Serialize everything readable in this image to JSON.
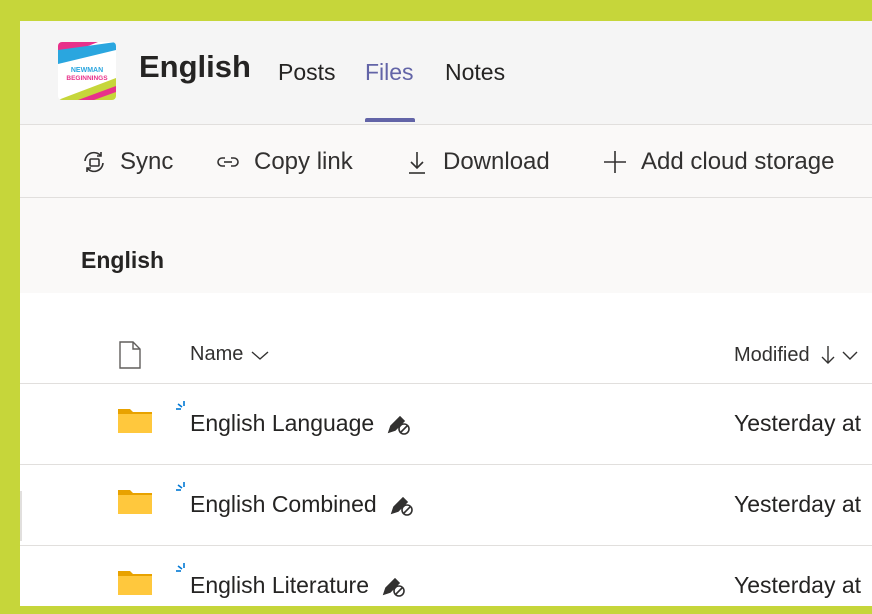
{
  "team": {
    "title": "English",
    "logo_text_top": "NEWMAN",
    "logo_text_bottom": "BEGINNINGS"
  },
  "tabs": [
    {
      "label": "Posts",
      "active": false
    },
    {
      "label": "Files",
      "active": true
    },
    {
      "label": "Notes",
      "active": false
    }
  ],
  "toolbar": {
    "sync_label": "Sync",
    "copy_link_label": "Copy link",
    "download_label": "Download",
    "add_cloud_label": "Add cloud storage"
  },
  "breadcrumb": {
    "title": "English"
  },
  "list": {
    "columns": {
      "name": "Name",
      "modified": "Modified"
    },
    "rows": [
      {
        "name": "English Language",
        "modified": "Yesterday at"
      },
      {
        "name": "English Combined",
        "modified": "Yesterday at"
      },
      {
        "name": "English Literature",
        "modified": "Yesterday at"
      }
    ]
  },
  "colors": {
    "accent": "#6264a7",
    "frame": "#c6d63a",
    "folder": "#ffb900",
    "spark": "#0078d4"
  }
}
